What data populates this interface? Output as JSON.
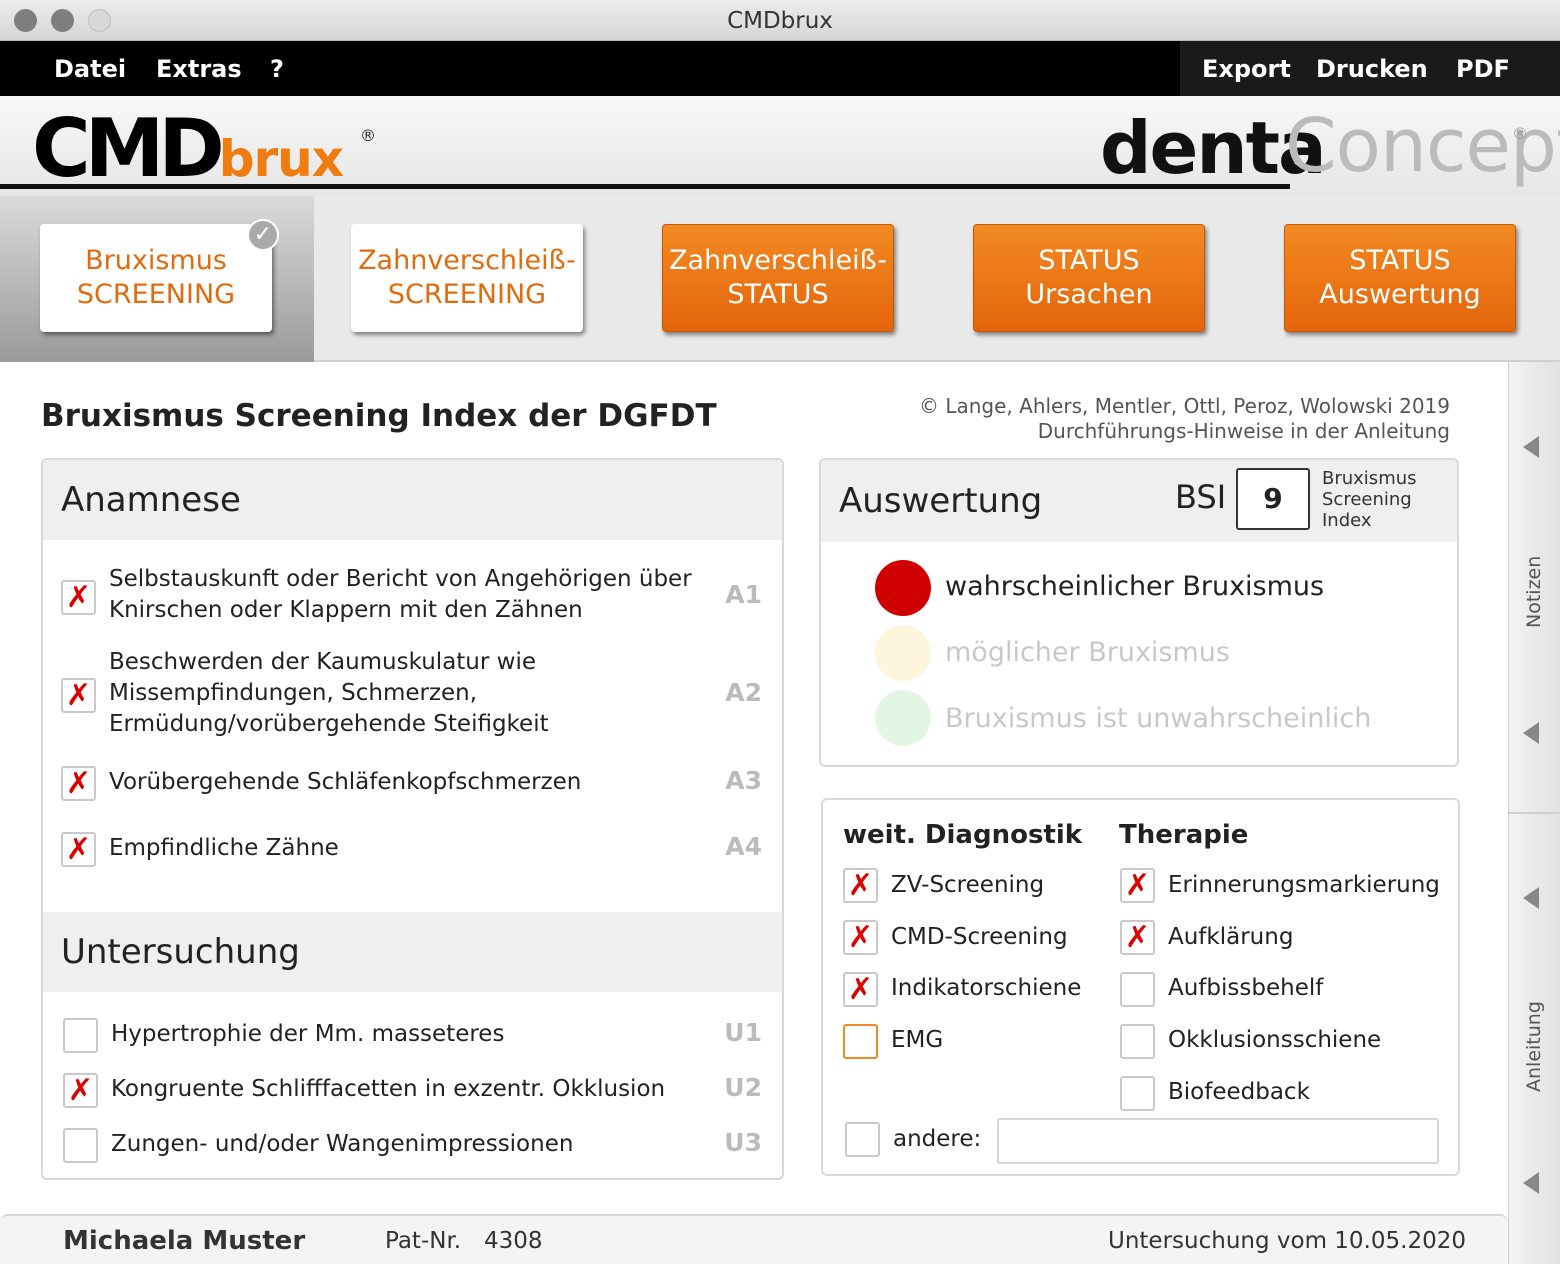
{
  "window": {
    "title": "CMDbrux"
  },
  "menu": {
    "left": [
      "Datei",
      "Extras",
      "?"
    ],
    "right": [
      "Export",
      "Drucken",
      "PDF"
    ]
  },
  "brand": {
    "logo_main": "CMD",
    "logo_sub": "brux",
    "logo_mark": "®",
    "partner_a": "denta",
    "partner_b": "Concept",
    "partner_mark": "®"
  },
  "tabs": [
    {
      "line1": "Bruxismus",
      "line2": "SCREENING"
    },
    {
      "line1": "Zahnverschleiß-",
      "line2": "SCREENING"
    },
    {
      "line1": "Zahnverschleiß-",
      "line2": "STATUS"
    },
    {
      "line1": "STATUS",
      "line2": "Ursachen"
    },
    {
      "line1": "STATUS",
      "line2": "Auswertung"
    }
  ],
  "page": {
    "title": "Bruxismus Screening Index der DGFDT",
    "copyright": "© Lange, Ahlers, Mentler, Ottl, Peroz, Wolowski 2019",
    "hint": "Durchführungs-Hinweise in der Anleitung"
  },
  "anamnese": {
    "heading": "Anamnese",
    "items": [
      {
        "line1": "Selbstauskunft oder Bericht von Angehörigen über",
        "line2": "Knirschen oder Klappern mit den Zähnen",
        "line3": "",
        "code": "A1",
        "checked": true
      },
      {
        "line1": "Beschwerden der Kaumuskulatur wie",
        "line2": "Missempfindungen, Schmerzen,",
        "line3": "Ermüdung/vorübergehende Steifigkeit",
        "code": "A2",
        "checked": true
      },
      {
        "line1": "Vorübergehende Schläfenkopfschmerzen",
        "line2": "",
        "line3": "",
        "code": "A3",
        "checked": true
      },
      {
        "line1": "Empfindliche Zähne",
        "line2": "",
        "line3": "",
        "code": "A4",
        "checked": true
      }
    ]
  },
  "untersuchung": {
    "heading": "Untersuchung",
    "items": [
      {
        "label": "Hypertrophie der Mm. masseteres",
        "code": "U1",
        "checked": false
      },
      {
        "label": "Kongruente Schlifffacetten in exzentr. Okklusion",
        "code": "U2",
        "checked": true
      },
      {
        "label": "Zungen- und/oder Wangenimpressionen",
        "code": "U3",
        "checked": false
      }
    ]
  },
  "auswertung": {
    "heading": "Auswertung",
    "bsi_label": "BSI",
    "bsi_value": "9",
    "bsi_caption1": "Bruxismus",
    "bsi_caption2": "Screening",
    "bsi_caption3": "Index",
    "results": [
      {
        "label": "wahrscheinlicher Bruxismus",
        "color": "#d00000",
        "text_color": "#222",
        "active": true
      },
      {
        "label": "möglicher Bruxismus",
        "color": "#fdf5dc",
        "text_color": "#c8c8c8",
        "active": false
      },
      {
        "label": "Bruxismus ist unwahrscheinlich",
        "color": "#e3f6e3",
        "text_color": "#c8c8c8",
        "active": false
      }
    ]
  },
  "diagnostik": {
    "heading": "weit. Diagnostik",
    "items": [
      {
        "label": "ZV-Screening",
        "checked": true
      },
      {
        "label": "CMD-Screening",
        "checked": true
      },
      {
        "label": "Indikatorschiene",
        "checked": true
      },
      {
        "label": "EMG",
        "checked": false
      }
    ]
  },
  "therapie": {
    "heading": "Therapie",
    "items": [
      {
        "label": "Erinnerungsmarkierung",
        "checked": true
      },
      {
        "label": "Aufklärung",
        "checked": true
      },
      {
        "label": "Aufbissbehelf",
        "checked": false
      },
      {
        "label": "Okklusionsschiene",
        "checked": false
      },
      {
        "label": "Biofeedback",
        "checked": false
      }
    ]
  },
  "andere": {
    "label": "andere:",
    "value": ""
  },
  "sidebar": {
    "notes": "Notizen",
    "guide": "Anleitung"
  },
  "footer": {
    "patient": "Michaela Muster",
    "patnr_label": "Pat-Nr.",
    "patnr": "4308",
    "exam": "Untersuchung vom 10.05.2020"
  },
  "colors": {
    "accent": "#ef7d14",
    "check": "#d00000"
  }
}
